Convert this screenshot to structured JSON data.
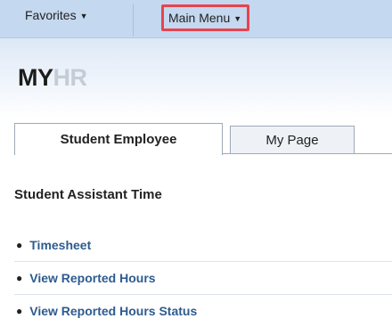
{
  "topbar": {
    "favorites_label": "Favorites",
    "main_menu_label": "Main Menu",
    "highlight_color": "#e8434e"
  },
  "header": {
    "logo_part1": "MY",
    "logo_part2": "HR"
  },
  "tabs": [
    {
      "label": "Student Employee",
      "active": true
    },
    {
      "label": "My Page",
      "active": false
    }
  ],
  "section": {
    "title": "Student Assistant Time",
    "links": [
      {
        "label": "Timesheet"
      },
      {
        "label": "View Reported Hours"
      },
      {
        "label": "View Reported Hours Status"
      }
    ]
  },
  "colors": {
    "topbar_bg": "#c4d8ef",
    "link": "#2d5b8f"
  }
}
